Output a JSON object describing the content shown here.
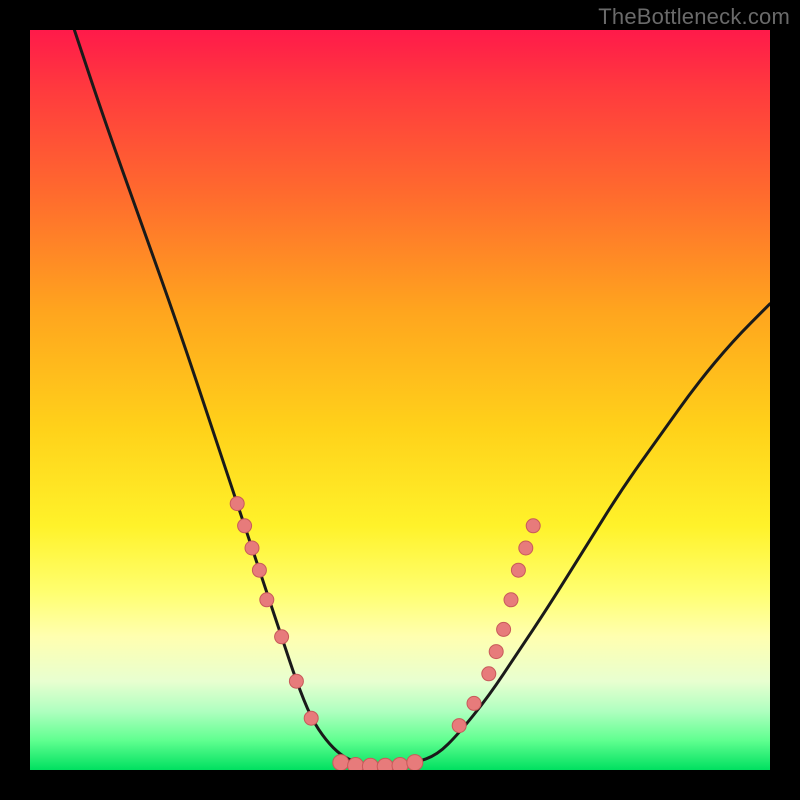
{
  "watermark": "TheBottleneck.com",
  "colors": {
    "background": "#000000",
    "curve": "#1a1a1a",
    "marker_fill": "#e77b7b",
    "marker_stroke": "#c85a5a"
  },
  "chart_data": {
    "type": "line",
    "title": "",
    "xlabel": "",
    "ylabel": "",
    "xlim": [
      0,
      100
    ],
    "ylim": [
      0,
      100
    ],
    "grid": false,
    "legend": false,
    "series": [
      {
        "name": "bottleneck-curve",
        "x": [
          6,
          10,
          15,
          20,
          25,
          28,
          30,
          32,
          34,
          36,
          38,
          40,
          42,
          44,
          46,
          48,
          50,
          52,
          55,
          58,
          62,
          66,
          70,
          75,
          80,
          85,
          90,
          95,
          100
        ],
        "y": [
          100,
          88,
          74,
          60,
          45,
          36,
          30,
          24,
          18,
          12,
          7,
          4,
          2,
          1,
          0.5,
          0.5,
          0.5,
          1,
          2,
          5,
          10,
          16,
          22,
          30,
          38,
          45,
          52,
          58,
          63
        ]
      }
    ],
    "markers": {
      "left_cluster": [
        {
          "x": 28,
          "y": 36
        },
        {
          "x": 29,
          "y": 33
        },
        {
          "x": 30,
          "y": 30
        },
        {
          "x": 31,
          "y": 27
        },
        {
          "x": 32,
          "y": 23
        },
        {
          "x": 34,
          "y": 18
        },
        {
          "x": 36,
          "y": 12
        },
        {
          "x": 38,
          "y": 7
        }
      ],
      "bottom_cluster": [
        {
          "x": 42,
          "y": 1
        },
        {
          "x": 44,
          "y": 0.6
        },
        {
          "x": 46,
          "y": 0.5
        },
        {
          "x": 48,
          "y": 0.5
        },
        {
          "x": 50,
          "y": 0.6
        },
        {
          "x": 52,
          "y": 1
        }
      ],
      "right_cluster": [
        {
          "x": 58,
          "y": 6
        },
        {
          "x": 60,
          "y": 9
        },
        {
          "x": 62,
          "y": 13
        },
        {
          "x": 63,
          "y": 16
        },
        {
          "x": 64,
          "y": 19
        },
        {
          "x": 65,
          "y": 23
        },
        {
          "x": 66,
          "y": 27
        },
        {
          "x": 67,
          "y": 30
        },
        {
          "x": 68,
          "y": 33
        }
      ]
    },
    "gradient_stops": [
      {
        "pos": 0,
        "color": "#ff1a4a"
      },
      {
        "pos": 8,
        "color": "#ff3a3e"
      },
      {
        "pos": 22,
        "color": "#ff6a2e"
      },
      {
        "pos": 38,
        "color": "#ffa51e"
      },
      {
        "pos": 54,
        "color": "#ffd21a"
      },
      {
        "pos": 67,
        "color": "#fff22a"
      },
      {
        "pos": 76,
        "color": "#ffff70"
      },
      {
        "pos": 82,
        "color": "#ffffb0"
      },
      {
        "pos": 88,
        "color": "#e8ffd0"
      },
      {
        "pos": 92,
        "color": "#b0ffc0"
      },
      {
        "pos": 96,
        "color": "#60ff90"
      },
      {
        "pos": 100,
        "color": "#00e060"
      }
    ]
  }
}
